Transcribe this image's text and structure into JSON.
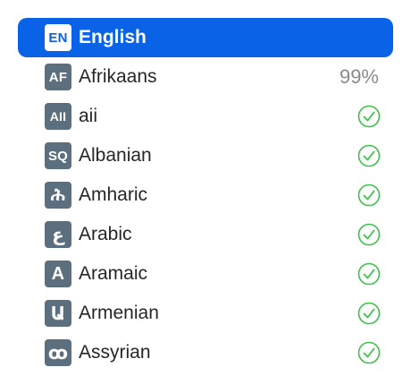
{
  "languages": [
    {
      "code": "EN",
      "name": "English",
      "selected": true,
      "status": ""
    },
    {
      "code": "AF",
      "name": "Afrikaans",
      "selected": false,
      "status": "99%"
    },
    {
      "code": "AII",
      "name": "aii",
      "selected": false,
      "status": "check"
    },
    {
      "code": "SQ",
      "name": "Albanian",
      "selected": false,
      "status": "check"
    },
    {
      "code": "ሕ",
      "name": "Amharic",
      "selected": false,
      "status": "check"
    },
    {
      "code": "ع",
      "name": "Arabic",
      "selected": false,
      "status": "check"
    },
    {
      "code": "A",
      "name": "Aramaic",
      "selected": false,
      "status": "check"
    },
    {
      "code": "Ա",
      "name": "Armenian",
      "selected": false,
      "status": "check"
    },
    {
      "code": "ꝏ",
      "name": "Assyrian",
      "selected": false,
      "status": "check"
    }
  ],
  "colors": {
    "accent": "#0a63e6",
    "badge": "#5b6f7e",
    "check": "#3cc24a",
    "percent_text": "#8a8a8a"
  },
  "icons": {
    "status_complete": "checkmark-circle-icon"
  }
}
